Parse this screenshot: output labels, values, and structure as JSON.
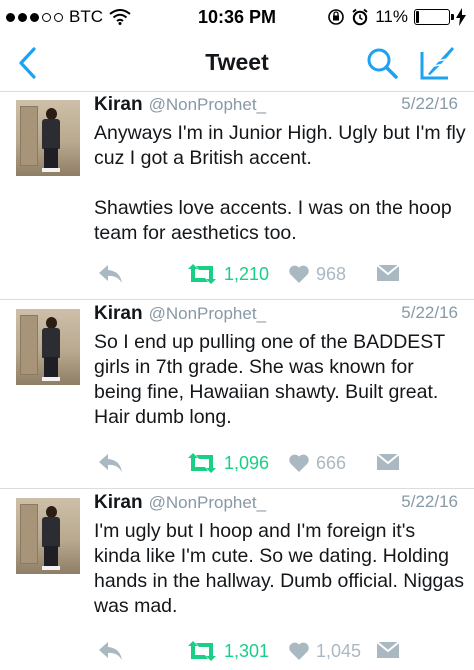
{
  "status_bar": {
    "carrier": "BTC",
    "time": "10:36 PM",
    "battery": "11%",
    "battery_level": 0.11,
    "signal_dots": 5,
    "signal_filled": 3
  },
  "nav": {
    "title": "Tweet"
  },
  "colors": {
    "accent": "#1da1f2",
    "retweet": "#19cf86",
    "muted": "#aab8c2"
  },
  "tweets": [
    {
      "name": "Kiran",
      "handle": "@NonProphet_",
      "date": "5/22/16",
      "text": "Anyways I'm in Junior High. Ugly but I'm fly cuz I got a British accent.\n\nShawties love accents. I was on the hoop team for aesthetics too.",
      "retweets": "1,210",
      "likes": "968"
    },
    {
      "name": "Kiran",
      "handle": "@NonProphet_",
      "date": "5/22/16",
      "text": "So I end up pulling one of the BADDEST girls in 7th grade. She was known for being fine, Hawaiian shawty. Built great. Hair dumb long.",
      "retweets": "1,096",
      "likes": "666"
    },
    {
      "name": "Kiran",
      "handle": "@NonProphet_",
      "date": "5/22/16",
      "text": "I'm ugly but I hoop and I'm foreign it's kinda like I'm cute. So we dating. Holding hands in the hallway. Dumb official. Niggas was mad.",
      "retweets": "1,301",
      "likes": "1,045"
    }
  ]
}
